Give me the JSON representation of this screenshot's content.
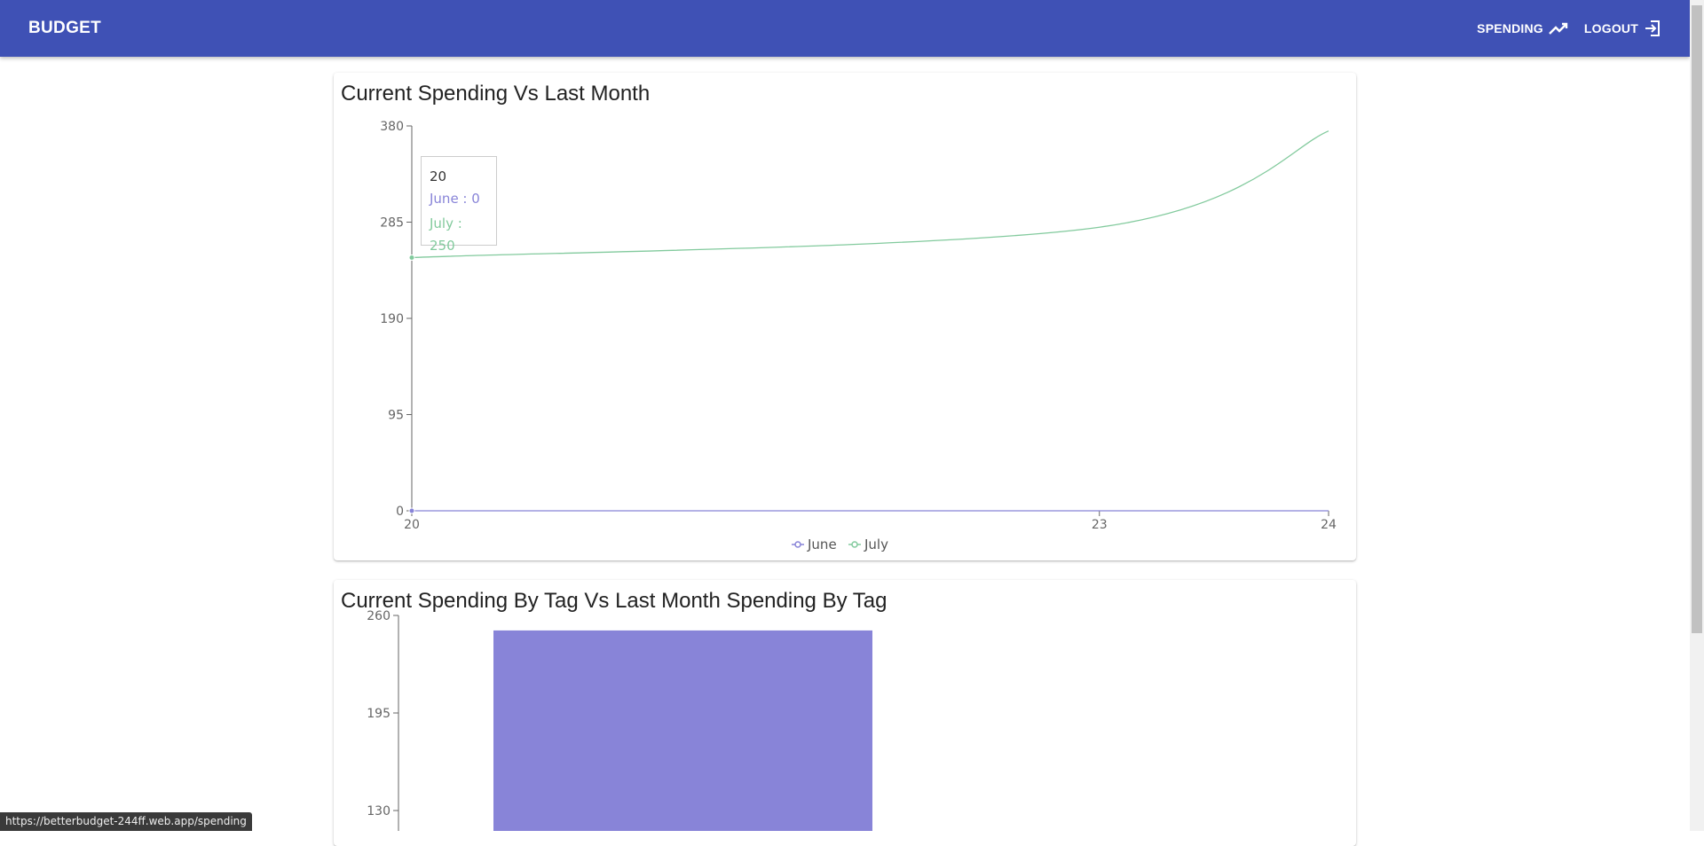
{
  "header": {
    "brand": "BUDGET",
    "spending_label": "SPENDING",
    "spending_icon": "trending-up-icon",
    "logout_label": "LOGOUT",
    "logout_icon": "logout-icon",
    "bg_color": "#3f51b5"
  },
  "line_card": {
    "title": "Current Spending Vs Last Month"
  },
  "tooltip": {
    "x": "20",
    "june": "June : 0",
    "july": "July : 250"
  },
  "bar_card": {
    "title": "Current Spending By Tag Vs Last Month Spending By Tag"
  },
  "status_url": "https://betterbudget-244ff.web.app/spending",
  "chart_data": [
    {
      "type": "line",
      "x": [
        20,
        23,
        24
      ],
      "series": [
        {
          "name": "June",
          "values": [
            0,
            0,
            0
          ],
          "color": "#8884d8"
        },
        {
          "name": "July",
          "values": [
            250,
            280,
            375
          ],
          "color": "#82ca9d"
        }
      ],
      "yticks": [
        0,
        95,
        190,
        285,
        380
      ],
      "ylim": [
        0,
        380
      ],
      "xticks": [
        "20",
        "23",
        "24"
      ],
      "legend": "bottom"
    },
    {
      "type": "bar",
      "categories": [
        ""
      ],
      "series": [
        {
          "values": [
            250
          ],
          "color": "#8884d8"
        }
      ],
      "yticks": [
        130,
        195,
        260
      ],
      "ylim": [
        0,
        260
      ]
    }
  ]
}
